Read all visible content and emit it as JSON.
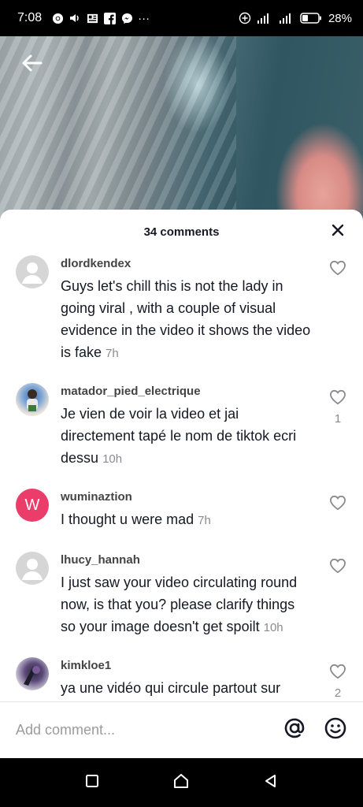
{
  "status_bar": {
    "time": "7:08",
    "more_indicator": "···",
    "battery_percent": "28%"
  },
  "video": {
    "back_icon": "arrow-left-icon"
  },
  "comments_panel": {
    "title": "34 comments",
    "close_icon": "close-icon",
    "comments": [
      {
        "username": "dlordkendex",
        "text": "Guys let's chill this is not the lady in going viral , with a couple of visual evidence in the video it shows the video is fake",
        "time": "7h",
        "likes": "",
        "avatar": "default-avatar"
      },
      {
        "username": "matador_pied_electrique",
        "text": "Je vien de voir la video et jai directement tapé le nom de tiktok ecri dessu",
        "time": "10h",
        "likes": "1",
        "avatar": "photo-avatar"
      },
      {
        "username": "wuminaztion",
        "text": "I thought u were mad",
        "time": "7h",
        "likes": "",
        "avatar": "letter-avatar",
        "avatar_letter": "W"
      },
      {
        "username": "lhucy_hannah",
        "text": "I just saw your video circulating round now, is that you? please clarify things so your image doesn't get spoilt",
        "time": "10h",
        "likes": "",
        "avatar": "default-avatar"
      },
      {
        "username": "kimkloe1",
        "text": "ya une vidéo qui circule partout sur",
        "time": "",
        "likes": "2",
        "avatar": "photo-avatar"
      }
    ]
  },
  "add_comment": {
    "placeholder": "Add comment...",
    "mention_icon": "at-sign-icon",
    "emoji_icon": "emoji-icon"
  },
  "colors": {
    "accent_pink": "#ea3d6a",
    "text_primary": "#161823",
    "text_secondary": "#8a8b91"
  }
}
